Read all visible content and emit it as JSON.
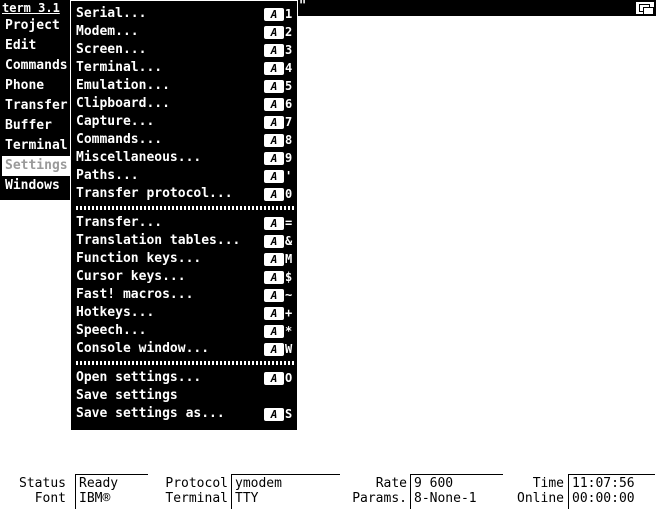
{
  "window": {
    "title": "term 3.1",
    "quote": "\""
  },
  "menu_strip": {
    "items": [
      {
        "label": "Project"
      },
      {
        "label": "Edit"
      },
      {
        "label": "Commands"
      },
      {
        "label": "Phone"
      },
      {
        "label": "Transfer"
      },
      {
        "label": "Buffer"
      },
      {
        "label": "Terminal"
      },
      {
        "label": "Settings"
      },
      {
        "label": "Windows"
      }
    ],
    "selected": "Settings"
  },
  "settings_menu": {
    "shortcut_glyph": "A",
    "groups": [
      [
        {
          "label": "Serial...",
          "key": "1"
        },
        {
          "label": "Modem...",
          "key": "2"
        },
        {
          "label": "Screen...",
          "key": "3"
        },
        {
          "label": "Terminal...",
          "key": "4"
        },
        {
          "label": "Emulation...",
          "key": "5"
        },
        {
          "label": "Clipboard...",
          "key": "6"
        },
        {
          "label": "Capture...",
          "key": "7"
        },
        {
          "label": "Commands...",
          "key": "8"
        },
        {
          "label": "Miscellaneous...",
          "key": "9"
        },
        {
          "label": "Paths...",
          "key": "'"
        },
        {
          "label": "Transfer protocol...",
          "key": "0"
        }
      ],
      [
        {
          "label": "Transfer...",
          "key": "="
        },
        {
          "label": "Translation tables...",
          "key": "&"
        },
        {
          "label": "Function keys...",
          "key": "M"
        },
        {
          "label": "Cursor keys...",
          "key": "$"
        },
        {
          "label": "Fast! macros...",
          "key": "~"
        },
        {
          "label": "Hotkeys...",
          "key": "+"
        },
        {
          "label": "Speech...",
          "key": "*"
        },
        {
          "label": "Console window...",
          "key": "W"
        }
      ],
      [
        {
          "label": "Open settings...",
          "key": "O"
        },
        {
          "label": "Save settings",
          "key": ""
        },
        {
          "label": "Save settings as...",
          "key": "S"
        }
      ]
    ]
  },
  "status": {
    "status_label": "Status",
    "status_value": "Ready",
    "font_label": "Font",
    "font_value": "IBM®",
    "protocol_label": "Protocol",
    "protocol_value": "ymodem",
    "terminal_label": "Terminal",
    "terminal_value": "TTY",
    "rate_label": "Rate",
    "rate_value": "9 600",
    "params_label": "Params.",
    "params_value": "8-None-1",
    "time_label": "Time",
    "time_value": "11:07:56",
    "online_label": "Online",
    "online_value": "00:00:00"
  }
}
